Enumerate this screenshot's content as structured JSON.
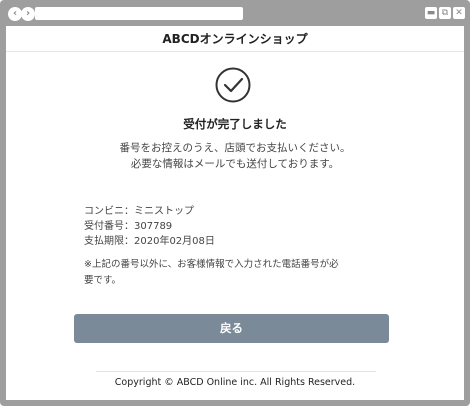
{
  "window": {
    "controls": {
      "minimize": "▬",
      "restore": "⧉",
      "close": "✕"
    }
  },
  "nav": {
    "back_icon": "arrow-left",
    "forward_icon": "arrow-right",
    "address_value": ""
  },
  "header": {
    "title": "ABCDオンラインショップ"
  },
  "status": {
    "icon": "check-circle-icon",
    "title": "受付が完了しました",
    "message_line1": "番号をお控えのうえ、店頭でお支払いください。",
    "message_line2": "必要な情報はメールでも送付しております。"
  },
  "payment_info": {
    "store": "コンビニ：ミニストップ",
    "receipt_number": "受付番号：307789",
    "deadline": "支払期限：2020年02月08日"
  },
  "note": {
    "line1": "※上記の番号以外に、お客様情報で入力された電話番号が必",
    "line2": "要です。"
  },
  "actions": {
    "back_label": "戻る"
  },
  "footer": {
    "copyright": "Copyright © ABCD Online inc. All Rights Reserved."
  },
  "colors": {
    "chrome": "#9e9e9e",
    "button": "#7b8a99"
  }
}
